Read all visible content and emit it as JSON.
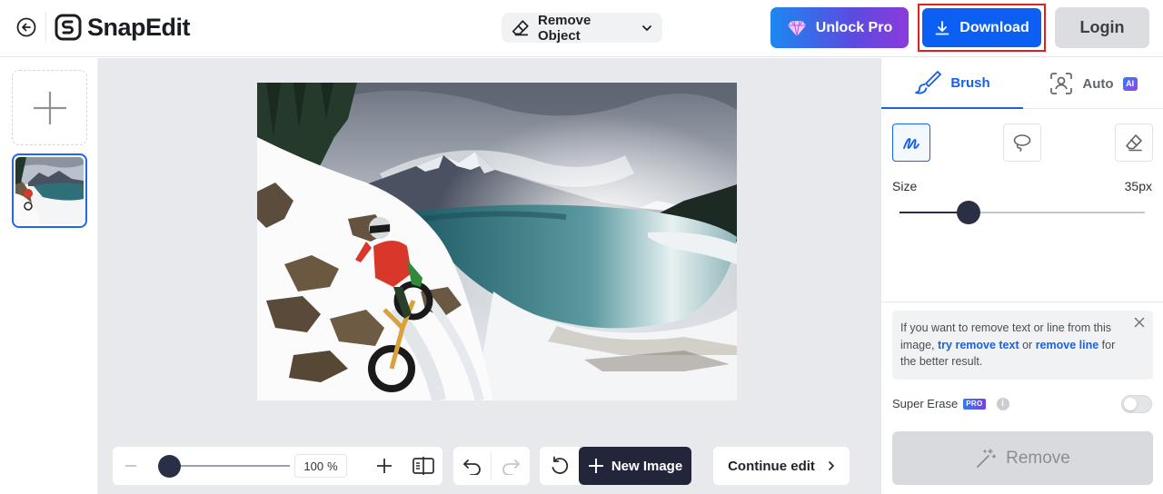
{
  "app": {
    "name": "SnapEdit"
  },
  "header": {
    "tool_label": "Remove Object",
    "unlock_label": "Unlock Pro",
    "download_label": "Download",
    "login_label": "Login"
  },
  "toolbar": {
    "zoom_value": "100",
    "zoom_unit": "%",
    "new_image_label": "New Image",
    "continue_label": "Continue edit"
  },
  "panel": {
    "tabs": [
      {
        "label": "Brush",
        "active": true,
        "icon": "brush-icon"
      },
      {
        "label": "Auto",
        "active": false,
        "icon": "auto-detect-icon",
        "badge": "AI"
      }
    ],
    "modes": [
      {
        "name": "brush-mode",
        "active": true
      },
      {
        "name": "lasso-mode",
        "active": false
      },
      {
        "name": "eraser-mode",
        "active": false
      }
    ],
    "size_label": "Size",
    "size_value": "35px",
    "size_level": 0.28,
    "info": {
      "part1": "If you want to remove text or line from this image, ",
      "link1": "try remove text",
      "part2": " or ",
      "link2": "remove line",
      "part3": " for the better result."
    },
    "super_erase_label": "Super Erase",
    "pro_badge": "PRO",
    "info_icon": "i",
    "super_erase_enabled": false,
    "remove_label": "Remove"
  },
  "colors": {
    "accent": "#1762e8",
    "download": "#0b5ff2",
    "highlight_border": "#e02020",
    "dark_button": "#23263a"
  }
}
